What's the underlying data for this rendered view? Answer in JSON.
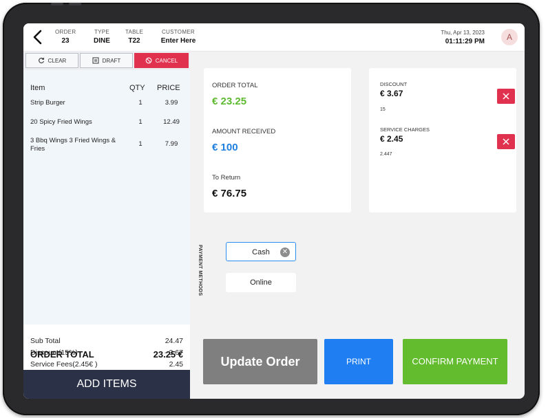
{
  "header": {
    "order_label": "ORDER",
    "order_value": "23",
    "type_label": "TYPE",
    "type_value": "DINE",
    "table_label": "TABLE",
    "table_value": "T22",
    "customer_label": "CUSTOMER",
    "customer_value": "Enter Here",
    "date": "Thu, Apr 13, 2023",
    "time": "01:11:29 PM",
    "avatar": "A"
  },
  "actions": {
    "clear": "CLEAR",
    "draft": "DRAFT",
    "cancel": "CANCEL"
  },
  "items": {
    "col_item": "Item",
    "col_qty": "QTY",
    "col_price": "PRICE",
    "rows": [
      {
        "name": "Strip Burger",
        "qty": "1",
        "price": "3.99"
      },
      {
        "name": "20 Spicy Fried Wings",
        "qty": "1",
        "price": "12.49"
      },
      {
        "name": "3 Bbq Wings 3 Fried Wings & Fries",
        "qty": "1",
        "price": "7.99"
      }
    ]
  },
  "totals": {
    "subtotal_label": "Sub Total",
    "subtotal_value": "24.47",
    "discount_label": "Discount(15%)",
    "discount_value": "- 3.67",
    "service_label": "Service Fees(2.45€ )",
    "service_value": "2.45",
    "order_total_label": "ORDER TOTAL",
    "order_total_value": "23.25 €"
  },
  "add_items": "ADD ITEMS",
  "summary": {
    "order_total_label": "ORDER TOTAL",
    "order_total_value": "€ 23.25",
    "amount_received_label": "AMOUNT RECEIVED",
    "amount_received_value": "€ 100",
    "to_return_label": "To Return",
    "to_return_value": "€ 76.75"
  },
  "adjustments": {
    "discount_label": "DISCOUNT",
    "discount_value": "€ 3.67",
    "discount_sub": "15",
    "service_label": "SERVICE CHARGES",
    "service_value": "€ 2.45",
    "service_sub": "2.447"
  },
  "payment": {
    "label": "PAYMENT METHODS",
    "methods": [
      "Cash",
      "Online"
    ]
  },
  "buttons": {
    "update": "Update Order",
    "print": "PRINT",
    "confirm": "CONFIRM PAYMENT"
  },
  "colors": {
    "green": "#5dba2f",
    "blue": "#1e7fe0",
    "red": "#e0314e",
    "navy": "#2b3248",
    "gray_button": "#7f7f7f",
    "print_blue": "#1f7ff2",
    "confirm_green": "#62bc2e"
  }
}
